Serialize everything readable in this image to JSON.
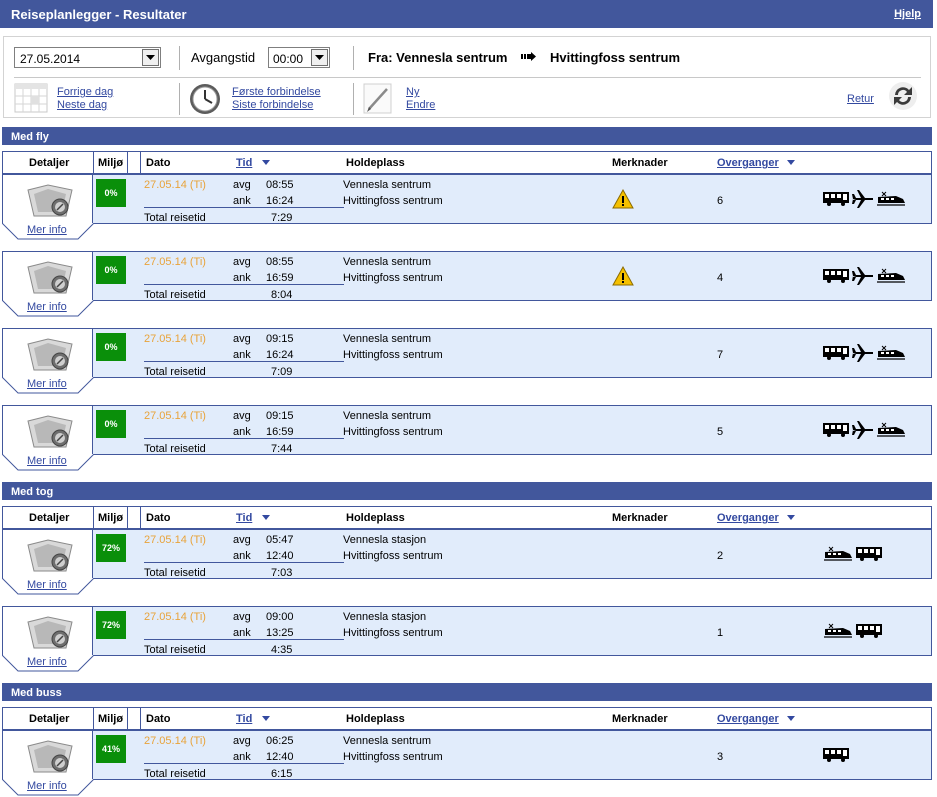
{
  "app": {
    "title": "Reiseplanlegger - Resultater",
    "help": "Hjelp"
  },
  "toolbar": {
    "date_value": "27.05.2014",
    "departure_label": "Avgangstid",
    "time_value": "00:00",
    "from_label": "Fra: Vennesla sentrum",
    "to_label": "Hvittingfoss sentrum",
    "prev_day": "Forrige dag",
    "next_day": "Neste dag",
    "first_conn": "Første forbindelse",
    "last_conn": "Siste forbindelse",
    "new": "Ny",
    "edit": "Endre",
    "back": "Retur"
  },
  "columns": {
    "details": "Detaljer",
    "env": "Miljø",
    "date": "Dato",
    "time": "Tid",
    "stop": "Holdeplass",
    "remarks": "Merknader",
    "transfers": "Overganger"
  },
  "labels": {
    "dep": "avg",
    "arr": "ank",
    "total": "Total reisetid",
    "more": "Mer info"
  },
  "sections": [
    {
      "title": "Med fly",
      "rows": [
        {
          "env": "0%",
          "date": "27.05.14 (Ti)",
          "dep": "08:55",
          "arr": "16:24",
          "total": "7:29",
          "from": "Vennesla sentrum",
          "to": "Hvittingfoss sentrum",
          "warning": true,
          "transfers": "6",
          "modes": [
            "bus-icon",
            "plane-icon",
            "train-icon"
          ]
        },
        {
          "env": "0%",
          "date": "27.05.14 (Ti)",
          "dep": "08:55",
          "arr": "16:59",
          "total": "8:04",
          "from": "Vennesla sentrum",
          "to": "Hvittingfoss sentrum",
          "warning": true,
          "transfers": "4",
          "modes": [
            "bus-icon",
            "plane-icon",
            "train-icon"
          ]
        },
        {
          "env": "0%",
          "date": "27.05.14 (Ti)",
          "dep": "09:15",
          "arr": "16:24",
          "total": "7:09",
          "from": "Vennesla sentrum",
          "to": "Hvittingfoss sentrum",
          "warning": false,
          "transfers": "7",
          "modes": [
            "bus-icon",
            "plane-icon",
            "train-icon"
          ]
        },
        {
          "env": "0%",
          "date": "27.05.14 (Ti)",
          "dep": "09:15",
          "arr": "16:59",
          "total": "7:44",
          "from": "Vennesla sentrum",
          "to": "Hvittingfoss sentrum",
          "warning": false,
          "transfers": "5",
          "modes": [
            "bus-icon",
            "plane-icon",
            "train-icon"
          ]
        }
      ]
    },
    {
      "title": "Med tog",
      "rows": [
        {
          "env": "72%",
          "date": "27.05.14 (Ti)",
          "dep": "05:47",
          "arr": "12:40",
          "total": "7:03",
          "from": "Vennesla stasjon",
          "to": "Hvittingfoss sentrum",
          "warning": false,
          "transfers": "2",
          "modes": [
            "train-icon",
            "bus-icon"
          ]
        },
        {
          "env": "72%",
          "date": "27.05.14 (Ti)",
          "dep": "09:00",
          "arr": "13:25",
          "total": "4:35",
          "from": "Vennesla stasjon",
          "to": "Hvittingfoss sentrum",
          "warning": false,
          "transfers": "1",
          "modes": [
            "train-icon",
            "bus-icon"
          ]
        }
      ]
    },
    {
      "title": "Med buss",
      "rows": [
        {
          "env": "41%",
          "date": "27.05.14 (Ti)",
          "dep": "06:25",
          "arr": "12:40",
          "total": "6:15",
          "from": "Vennesla sentrum",
          "to": "Hvittingfoss sentrum",
          "warning": false,
          "transfers": "3",
          "modes": [
            "bus-icon"
          ]
        }
      ]
    }
  ]
}
